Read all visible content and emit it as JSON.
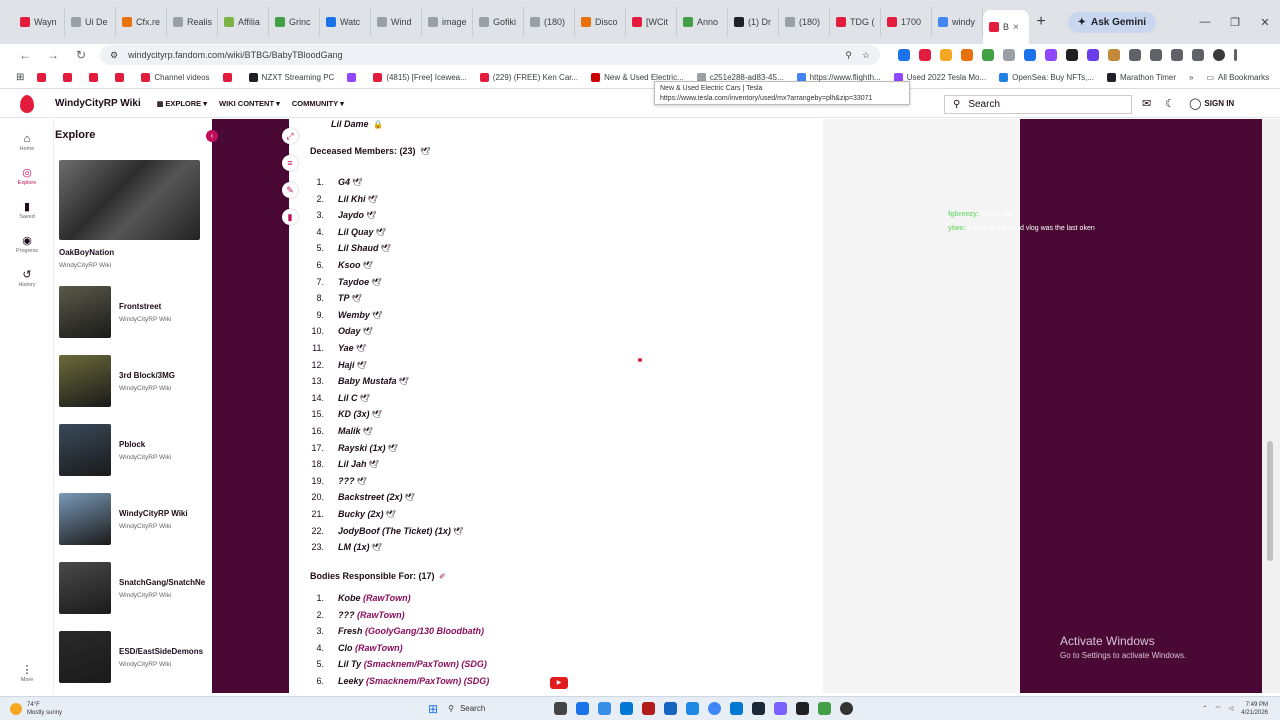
{
  "browser": {
    "tabs": [
      {
        "label": "Wayn",
        "color": "#e31b3c"
      },
      {
        "label": "Ui De",
        "color": "#9aa0a6"
      },
      {
        "label": "Cfx.re",
        "color": "#e8710a"
      },
      {
        "label": "Realis",
        "color": "#9aa0a6"
      },
      {
        "label": "Affilia",
        "color": "#7cb342"
      },
      {
        "label": "Grinc",
        "color": "#43a047"
      },
      {
        "label": "Watc",
        "color": "#1a73e8"
      },
      {
        "label": "Wind",
        "color": "#9aa0a6"
      },
      {
        "label": "image",
        "color": "#9aa0a6"
      },
      {
        "label": "Gofiki",
        "color": "#9aa0a6"
      },
      {
        "label": "(180)",
        "color": "#9aa0a6"
      },
      {
        "label": "Disco",
        "color": "#e8710a"
      },
      {
        "label": "[WCit",
        "color": "#e31b3c"
      },
      {
        "label": "Anno",
        "color": "#43a047"
      },
      {
        "label": "(1) Dr",
        "color": "#202124"
      },
      {
        "label": "(180)",
        "color": "#9aa0a6"
      },
      {
        "label": "TDG (",
        "color": "#e31b3c"
      },
      {
        "label": "1700",
        "color": "#e31b3c"
      },
      {
        "label": "windy",
        "color": "#4285f4"
      }
    ],
    "active_tab": {
      "label": "B",
      "close": "×"
    },
    "new_tab": "+",
    "ask_gemini": "Ask Gemini",
    "url": "windycityrp.fandom.com/wiki/BTBG/BabyTBloodGang",
    "bookmarks": [
      {
        "label": "",
        "color": "#e31b3c"
      },
      {
        "label": "",
        "color": "#e31b3c"
      },
      {
        "label": "",
        "color": "#e31b3c"
      },
      {
        "label": "",
        "color": "#e31b3c"
      },
      {
        "label": "Channel videos",
        "color": "#e31b3c"
      },
      {
        "label": "",
        "color": "#e31b3c"
      },
      {
        "label": "NZXT Streaming PC",
        "color": "#202124"
      },
      {
        "label": "",
        "color": "#9146ff"
      },
      {
        "label": "(4815) [Free] Icewea...",
        "color": "#e31b3c"
      },
      {
        "label": "(229) (FREE) Ken Car...",
        "color": "#e31b3c"
      },
      {
        "label": "New & Used Electric...",
        "color": "#cc0000"
      },
      {
        "label": "c251e288-ad83-45...",
        "color": "#9aa0a6"
      },
      {
        "label": "https://www.flighth...",
        "color": "#4285f4"
      },
      {
        "label": "Used 2022 Tesla Mo...",
        "color": "#9146ff"
      },
      {
        "label": "OpenSea: Buy NFTs,...",
        "color": "#2081e2"
      },
      {
        "label": "Marathon Timer",
        "color": "#202124"
      }
    ],
    "all_bookmarks": "All Bookmarks",
    "tooltip_title": "New & Used Electric Cars | Tesla",
    "tooltip_url": "https://www.tesla.com/inventory/used/mx?arrangeby=plh&zip=33071"
  },
  "header": {
    "wiki_name": "WindyCityRP Wiki",
    "nav": [
      "EXPLORE",
      "WIKI CONTENT",
      "COMMUNITY"
    ],
    "search_placeholder": "Search",
    "sign_in": "SIGN IN"
  },
  "rail": [
    {
      "label": "Home",
      "icon": "⌂"
    },
    {
      "label": "Explore",
      "icon": "◎",
      "active": true
    },
    {
      "label": "Saved",
      "icon": "▮"
    },
    {
      "label": "Progress",
      "icon": "◉"
    },
    {
      "label": "History",
      "icon": "↺"
    }
  ],
  "rail_more": "More",
  "explore": {
    "title": "Explore",
    "featured": {
      "title": "OakBoyNation",
      "sub": "WindyCityRP Wiki"
    },
    "items": [
      {
        "title": "Frontstreet",
        "sub": "WindyCityRP Wiki",
        "color": "#5a5a4a"
      },
      {
        "title": "3rd Block/3MG",
        "sub": "WindyCityRP Wiki",
        "color": "#6b6b3a"
      },
      {
        "title": "Pblock",
        "sub": "WindyCityRP Wiki",
        "color": "#3a4a5a"
      },
      {
        "title": "WindyCityRP Wiki",
        "sub": "WindyCityRP Wiki",
        "color": "#7a9ab8"
      },
      {
        "title": "SnatchGang/SnatchNe",
        "sub": "WindyCityRP Wiki",
        "color": "#4a4a4a"
      },
      {
        "title": "ESD/EastSideDemons",
        "sub": "WindyCityRP Wiki",
        "color": "#2a2a2a"
      }
    ]
  },
  "content": {
    "prev_member": "Lil Dame",
    "deceased_heading": "Deceased Members: (23)",
    "deceased": [
      "G4",
      "Lil Khi",
      "Jaydo",
      "Lil Quay",
      "Lil Shaud",
      "Ksoo",
      "Taydoe",
      "TP",
      "Wemby",
      "Oday",
      "Yae",
      "Haji",
      "Baby Mustafa",
      "Lil C",
      "KD (3x)",
      "Malik",
      "Rayski (1x)",
      "Lil Jah",
      "???",
      "Backstreet (2x)",
      "Bucky (2x)",
      "JodyBoof (The Ticket) (1x)",
      "LM (1x)"
    ],
    "bodies_heading": "Bodies Responsible For: (17)",
    "bodies": [
      {
        "name": "Kobe",
        "gang": "(RawTown)"
      },
      {
        "name": "???",
        "gang": "(RawTown)"
      },
      {
        "name": "Fresh",
        "gang": "(GoolyGang/130 Bloodbath)"
      },
      {
        "name": "Clo",
        "gang": "(RawTown)"
      },
      {
        "name": "Lil Ty",
        "gang": "(Smacknem/PaxTown) (SDG)"
      },
      {
        "name": "Leeky",
        "gang": "(Smacknem/PaxTown) (SDG)"
      }
    ]
  },
  "chat": [
    {
      "user": "fgbreezy:",
      "msg": "be not him"
    },
    {
      "user": "ytwe:",
      "msg": "o died at the good vlog was the last oken"
    }
  ],
  "activate": {
    "line1": "Activate Windows",
    "line2": "Go to Settings to activate Windows."
  },
  "taskbar": {
    "weather_temp": "74°F",
    "weather_desc": "Mostly sunny",
    "search": "Search",
    "time": "7:49 PM",
    "date": "4/21/2026"
  }
}
